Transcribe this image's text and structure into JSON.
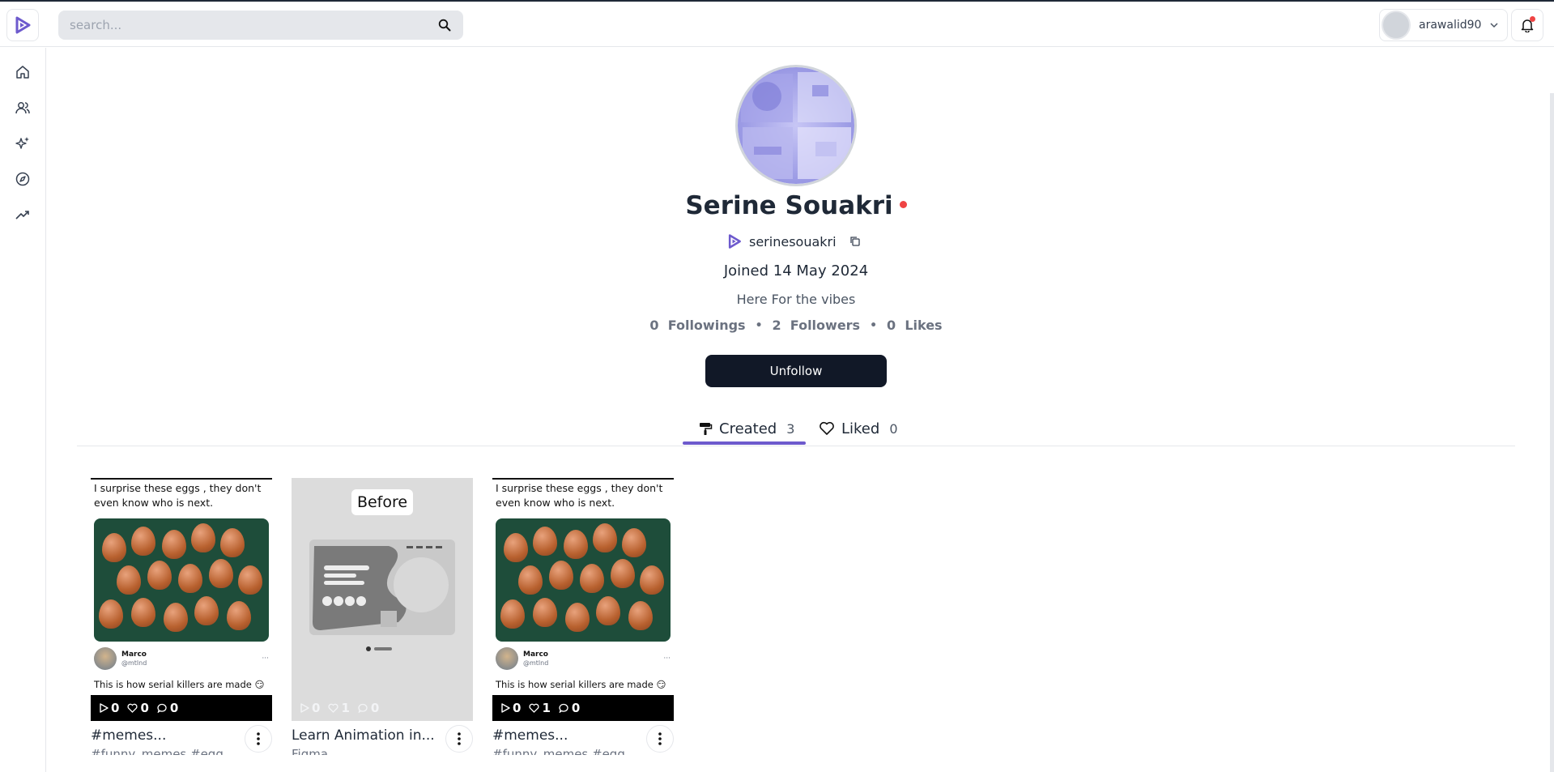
{
  "header": {
    "search_placeholder": "search...",
    "username": "arawalid90"
  },
  "sidebar": {
    "items": [
      {
        "name": "home-icon"
      },
      {
        "name": "users-icon"
      },
      {
        "name": "sparkles-icon"
      },
      {
        "name": "compass-icon"
      },
      {
        "name": "trending-icon"
      }
    ]
  },
  "profile": {
    "name": "Serine Souakri",
    "handle": "serinesouakri",
    "joined": "Joined 14 May 2024",
    "bio": "Here For the vibes",
    "followings_count": "0",
    "followings_label": "Followings",
    "followers_count": "2",
    "followers_label": "Followers",
    "likes_count": "0",
    "likes_label": "Likes",
    "unfollow_label": "Unfollow"
  },
  "tabs": [
    {
      "label": "Created",
      "count": "3",
      "active": true
    },
    {
      "label": "Liked",
      "count": "0",
      "active": false
    }
  ],
  "cards": [
    {
      "caption": "I surprise these eggs , they don't even know who is next.",
      "tweet_name": "Marco",
      "tweet_handle": "@mtlnd",
      "tweet_text": "This is how serial killers are made 😏",
      "plays": "0",
      "likes": "0",
      "comments": "0",
      "title": "#memes...",
      "subtitle": "#funny_memes #egg"
    },
    {
      "before_label": "Before",
      "plays": "0",
      "likes": "1",
      "comments": "0",
      "title": "Learn Animation in...",
      "subtitle": "Figma"
    },
    {
      "caption": "I surprise these eggs , they don't even know who is next.",
      "tweet_name": "Marco",
      "tweet_handle": "@mtlnd",
      "tweet_text": "This is how serial killers are made 😏",
      "plays": "0",
      "likes": "1",
      "comments": "0",
      "title": "#memes...",
      "subtitle": "#funny_memes #egg"
    }
  ],
  "colors": {
    "accent": "#6d5acd",
    "primary_button": "#111827",
    "online_dot": "#ef4444"
  }
}
